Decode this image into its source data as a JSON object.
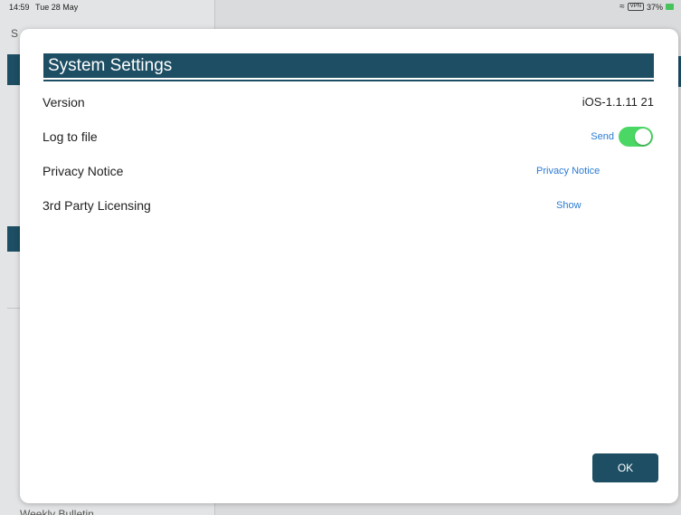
{
  "status_bar": {
    "time": "14:59",
    "date": "Tue 28 May",
    "battery_percent": "37%",
    "network": "VPN"
  },
  "background": {
    "sidebar_initial": "S",
    "bottom_item": "Weekly Bulletin"
  },
  "dialog": {
    "title": "System Settings",
    "rows": [
      {
        "label": "Version",
        "value": "iOS-1.1.11 21"
      },
      {
        "label": "Log to file",
        "action_label": "Send",
        "toggle_on": true
      },
      {
        "label": "Privacy Notice",
        "link": "Privacy Notice"
      },
      {
        "label": "3rd Party Licensing",
        "link": "Show"
      }
    ],
    "ok_label": "OK"
  },
  "colors": {
    "accent": "#1d4e63",
    "link": "#2a7bd3",
    "toggle_on": "#4bd764"
  }
}
